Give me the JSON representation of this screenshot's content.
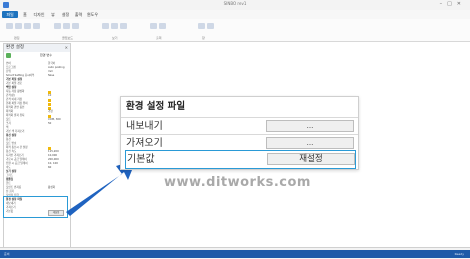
{
  "window": {
    "title": "SINBO rev1"
  },
  "ribbon_tabs": [
    "파일",
    "홈",
    "디자인",
    "뷰",
    "설정",
    "출력",
    "윈도우"
  ],
  "ribbon_groups": [
    "편집",
    "클립보드",
    "보기",
    "출력",
    "창"
  ],
  "panel": {
    "title": "환경 설정",
    "header": "환경 변수",
    "rows": [
      {
        "label": "언어",
        "value": "한국어",
        "kind": "text"
      },
      {
        "label": "프로그램",
        "value": "Auto posting",
        "kind": "text"
      },
      {
        "label": "단위",
        "value": "mm",
        "kind": "text"
      },
      {
        "label": "Smart Setting 표시여부",
        "value": "false",
        "kind": "text"
      },
      {
        "label": "기본 파일 설정",
        "value": "",
        "kind": "sec"
      },
      {
        "label": "기본 파일 경로",
        "value": "",
        "kind": "text"
      },
      {
        "label": "백업 설정",
        "value": "",
        "kind": "sec"
      },
      {
        "label": "자동 저장 활성화",
        "value": "",
        "kind": "y"
      },
      {
        "label": "간격(분)",
        "value": "10",
        "kind": "text"
      },
      {
        "label": "간격 이내 저장",
        "value": "",
        "kind": "y"
      },
      {
        "label": "현재 파일 저장 위치",
        "value": "",
        "kind": "y"
      },
      {
        "label": "최적화 관련 옵션",
        "value": "",
        "kind": "y"
      },
      {
        "label": "최적화",
        "value": "가장",
        "kind": "text"
      },
      {
        "label": "최적화 결과 유지",
        "value": "",
        "kind": "y"
      },
      {
        "label": "포트",
        "value": "COM, 300",
        "kind": "text"
      },
      {
        "label": "크기",
        "value": "50",
        "kind": "text"
      },
      {
        "label": "색",
        "value": "",
        "kind": "text"
      },
      {
        "label": "기본 색 가져오기",
        "value": "",
        "kind": "text"
      },
      {
        "label": "통신 설정",
        "value": "",
        "kind": "sec"
      },
      {
        "label": "통신",
        "value": "",
        "kind": "text"
      },
      {
        "label": "포트 번호",
        "value": "",
        "kind": "text"
      },
      {
        "label": "최적 통신시 간 설정",
        "value": "",
        "kind": "y"
      },
      {
        "label": "통신 속도",
        "value": "115,200",
        "kind": "text"
      },
      {
        "label": "디자인 가져오기",
        "value": "10,000",
        "kind": "text"
      },
      {
        "label": "가로시 공급 딜레이",
        "value": "200,000",
        "kind": "text"
      },
      {
        "label": "전환 시 공급 딜레이",
        "value": "10, 100",
        "kind": "text"
      },
      {
        "label": "속도",
        "value": "60",
        "kind": "text"
      },
      {
        "label": "보기 설정",
        "value": "",
        "kind": "sec"
      },
      {
        "label": "그리드",
        "value": "",
        "kind": "text"
      },
      {
        "label": "템플릿",
        "value": "",
        "kind": "sec"
      },
      {
        "label": "폰트",
        "value": "",
        "kind": "text"
      },
      {
        "label": "포인트 반지름",
        "value": "활성화",
        "kind": "text"
      },
      {
        "label": "선 굵기",
        "value": "",
        "kind": "text"
      },
      {
        "label": "포인터 진한",
        "value": "",
        "kind": "text"
      }
    ],
    "settings_file": {
      "section": "환경 설정 파일",
      "export": "내보내기",
      "import": "가져오기",
      "default": "기본값",
      "reset": "재설정"
    }
  },
  "callout": {
    "title": "환경 설정 파일",
    "rows": [
      {
        "label": "내보내기",
        "button": "..."
      },
      {
        "label": "가져오기",
        "button": "..."
      },
      {
        "label": "기본값",
        "button": "재설정"
      }
    ]
  },
  "watermark": "www.ditworks.com",
  "bottom_tabs": [
    "환경 설정",
    "디자인 속성"
  ],
  "statusbar": {
    "left": "준비",
    "right": "Ready"
  },
  "colors": {
    "accent": "#1e73be",
    "highlight": "#2a9ad6",
    "status": "#1e5aa8",
    "arrow": "#1f63c0"
  }
}
